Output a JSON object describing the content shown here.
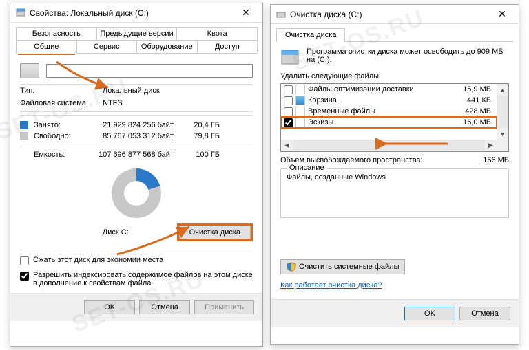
{
  "props": {
    "title": "Свойства: Локальный диск (C:)",
    "tabs_row1": [
      "Безопасность",
      "Предыдущие версии",
      "Квота"
    ],
    "tabs_row2": [
      "Общие",
      "Сервис",
      "Оборудование",
      "Доступ"
    ],
    "active_tab": "Общие",
    "drive_name": "",
    "type_label": "Тип:",
    "type_value": "Локальный диск",
    "fs_label": "Файловая система:",
    "fs_value": "NTFS",
    "used_label": "Занято:",
    "used_bytes": "21 929 824 256 байт",
    "used_gb": "20,4 ГБ",
    "free_label": "Свободно:",
    "free_bytes": "85 767 053 312 байт",
    "free_gb": "79,8 ГБ",
    "cap_label": "Емкость:",
    "cap_bytes": "107 696 877 568 байт",
    "cap_gb": "100 ГБ",
    "disk_label": "Диск C:",
    "cleanup_btn": "Очистка диска",
    "compress_label": "Сжать этот диск для экономии места",
    "index_label": "Разрешить индексировать содержимое файлов на этом диске в дополнение к свойствам файла",
    "ok": "OK",
    "cancel": "Отмена",
    "apply": "Применить"
  },
  "cleanup": {
    "title": "Очистка диска  (C:)",
    "tab": "Очистка диска",
    "intro": "Программа очистки диска может освободить до 909 МБ на  (C:).",
    "delete_label": "Удалить следующие файлы:",
    "files": [
      {
        "name": "Файлы оптимизации доставки",
        "size": "15,9 МБ",
        "checked": false,
        "icon": "file"
      },
      {
        "name": "Корзина",
        "size": "441 КБ",
        "checked": false,
        "icon": "recycle"
      },
      {
        "name": "Временные файлы",
        "size": "428 МБ",
        "checked": false,
        "icon": "file"
      },
      {
        "name": "Эскизы",
        "size": "16,0 МБ",
        "checked": true,
        "icon": "file"
      }
    ],
    "total_label": "Объем высвобождаемого пространства:",
    "total_value": "156 МБ",
    "desc_title": "Описание",
    "desc_text": "Файлы, созданные Windows",
    "sysfiles_btn": "Очистить системные файлы",
    "how_link": "Как работает очистка диска?",
    "ok": "OK",
    "cancel": "Отмена"
  },
  "chart_data": {
    "type": "pie",
    "title": "Диск C:",
    "series": [
      {
        "name": "Занято",
        "value": 20.4,
        "color": "#2b7ac9"
      },
      {
        "name": "Свободно",
        "value": 79.8,
        "color": "#c7c7c7"
      }
    ],
    "unit": "ГБ",
    "total": 100
  }
}
